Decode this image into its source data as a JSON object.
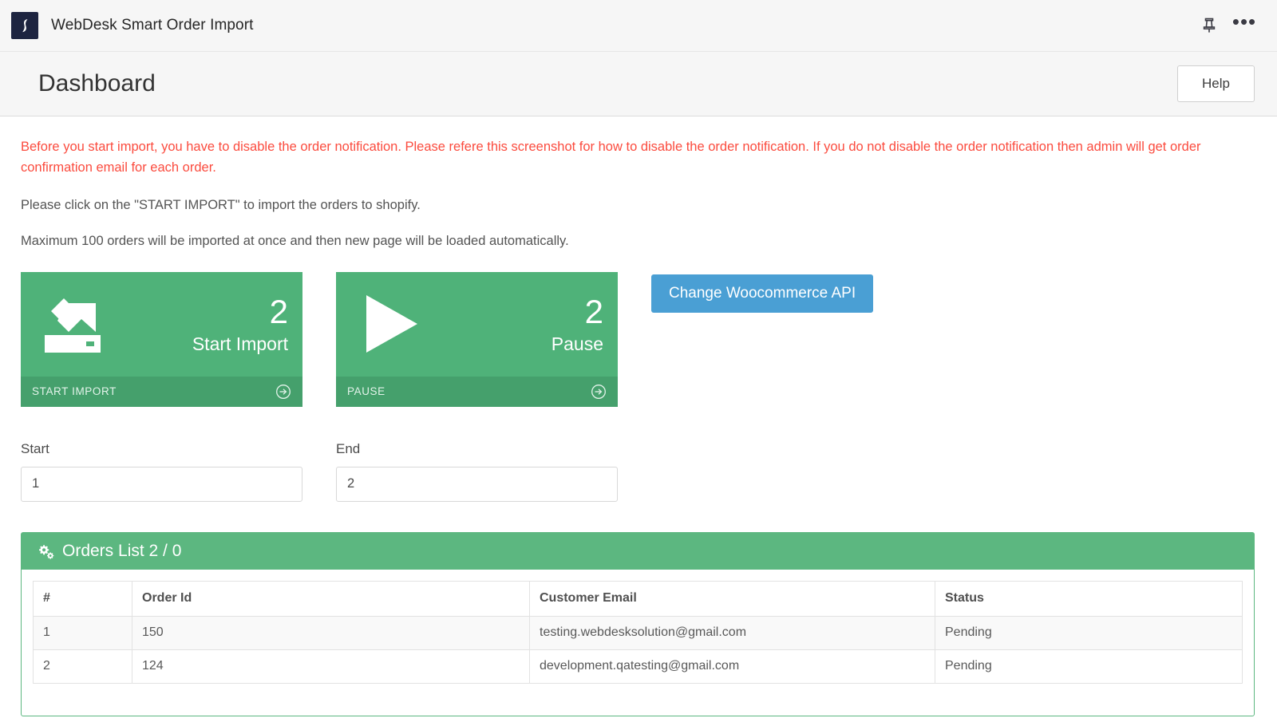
{
  "titlebar": {
    "app_title": "WebDesk Smart Order Import",
    "logo_icon": "webdesk-logo-icon",
    "pin_icon": "pin-icon",
    "overflow_icon": "ellipsis-icon",
    "overflow_label": "•••"
  },
  "pageheader": {
    "title": "Dashboard",
    "help_label": "Help"
  },
  "messages": {
    "warning": "Before you start import, you have to disable the order notification. Please refere this screenshot for how to disable the order notification. If you do not disable the order notification then admin will get order confirmation email for each order.",
    "instruction": "Please click on the \"START IMPORT\" to import the orders to shopify.",
    "note": "Maximum 100 orders will be imported at once and then new page will be loaded automatically."
  },
  "tiles": [
    {
      "count": "2",
      "label": "Start Import",
      "footer_label": "START IMPORT",
      "icon": "import-to-drive-icon",
      "arrow_icon": "arrow-circle-right-icon"
    },
    {
      "count": "2",
      "label": "Pause",
      "footer_label": "PAUSE",
      "icon": "play-icon",
      "arrow_icon": "arrow-circle-right-icon"
    }
  ],
  "api_button": {
    "label": "Change Woocommerce API"
  },
  "range": {
    "start_label": "Start",
    "start_value": "1",
    "start_placeholder": "Start",
    "end_label": "End",
    "end_value": "2",
    "end_placeholder": "End"
  },
  "orders_panel": {
    "icon": "cogs-icon",
    "title": "Orders List 2 / 0",
    "columns": [
      "#",
      "Order Id",
      "Customer Email",
      "Status"
    ],
    "rows": [
      {
        "num": "1",
        "order_id": "150",
        "email": "testing.webdesksolution@gmail.com",
        "status": "Pending"
      },
      {
        "num": "2",
        "order_id": "124",
        "email": "development.qatesting@gmail.com",
        "status": "Pending"
      }
    ]
  },
  "colors": {
    "tile_green": "#4fb279",
    "tile_footer_green": "#45a06c",
    "panel_green": "#5cb780",
    "api_blue": "#4a9fd4",
    "warning_red": "#fb4b3e",
    "logo_navy": "#1d2440"
  }
}
